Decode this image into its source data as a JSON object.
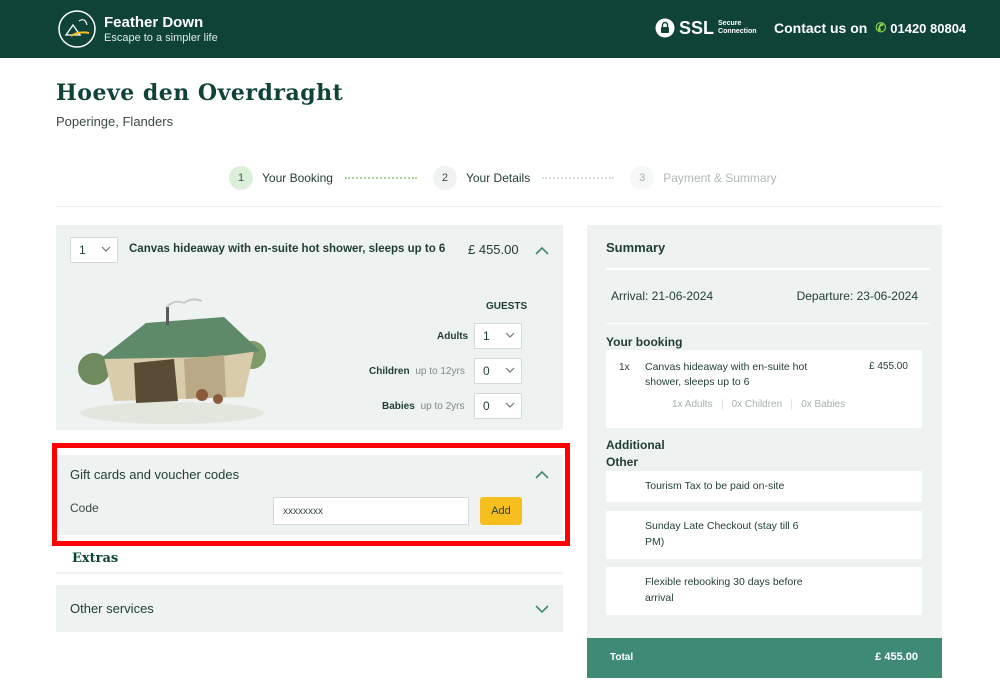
{
  "header": {
    "brand_name": "Feather Down",
    "brand_tagline": "Escape to a simpler life",
    "ssl_label": "SSL",
    "ssl_sub": "Secure Connection",
    "contact_label": "Contact us on",
    "phone": "01420 80804"
  },
  "property": {
    "name": "Hoeve den Overdraght",
    "location": "Poperinge, Flanders"
  },
  "steps": [
    {
      "num": "1",
      "label": "Your Booking"
    },
    {
      "num": "2",
      "label": "Your Details"
    },
    {
      "num": "3",
      "label": "Payment & Summary"
    }
  ],
  "room": {
    "quantity": "1",
    "name": "Canvas hideaway with en-suite hot shower, sleeps up to 6",
    "price": "£ 455.00",
    "guests_header": "GUESTS",
    "adults_label": "Adults",
    "adults_value": "1",
    "children_label": "Children",
    "children_sub": "up to 12yrs",
    "children_value": "0",
    "babies_label": "Babies",
    "babies_sub": "up to 2yrs",
    "babies_value": "0"
  },
  "voucher": {
    "title": "Gift cards and voucher codes",
    "code_label": "Code",
    "code_value": "xxxxxxxx",
    "add_label": "Add"
  },
  "extras": {
    "title": "Extras",
    "other_services": "Other services"
  },
  "summary": {
    "title": "Summary",
    "arrival": "Arrival: 21-06-2024",
    "departure": "Departure: 23-06-2024",
    "your_booking": "Your booking",
    "booking_qty": "1x",
    "booking_name": "Canvas hideaway with en-suite hot shower, sleeps up to 6",
    "booking_price": "£ 455.00",
    "adults": "1x Adults",
    "children": "0x Children",
    "babies": "0x Babies",
    "additional": "Additional",
    "other": "Other",
    "extras_items": [
      "Tourism Tax to be paid on-site",
      "Sunday Late Checkout (stay till 6 PM)",
      "Flexible rebooking 30 days before arrival"
    ],
    "total_label": "Total",
    "total_value": "£ 455.00"
  },
  "colors": {
    "header_bg": "#0f4337",
    "accent_button": "#f7bf1d",
    "total_bar": "#3f8a73",
    "highlight": "#ff0000"
  }
}
